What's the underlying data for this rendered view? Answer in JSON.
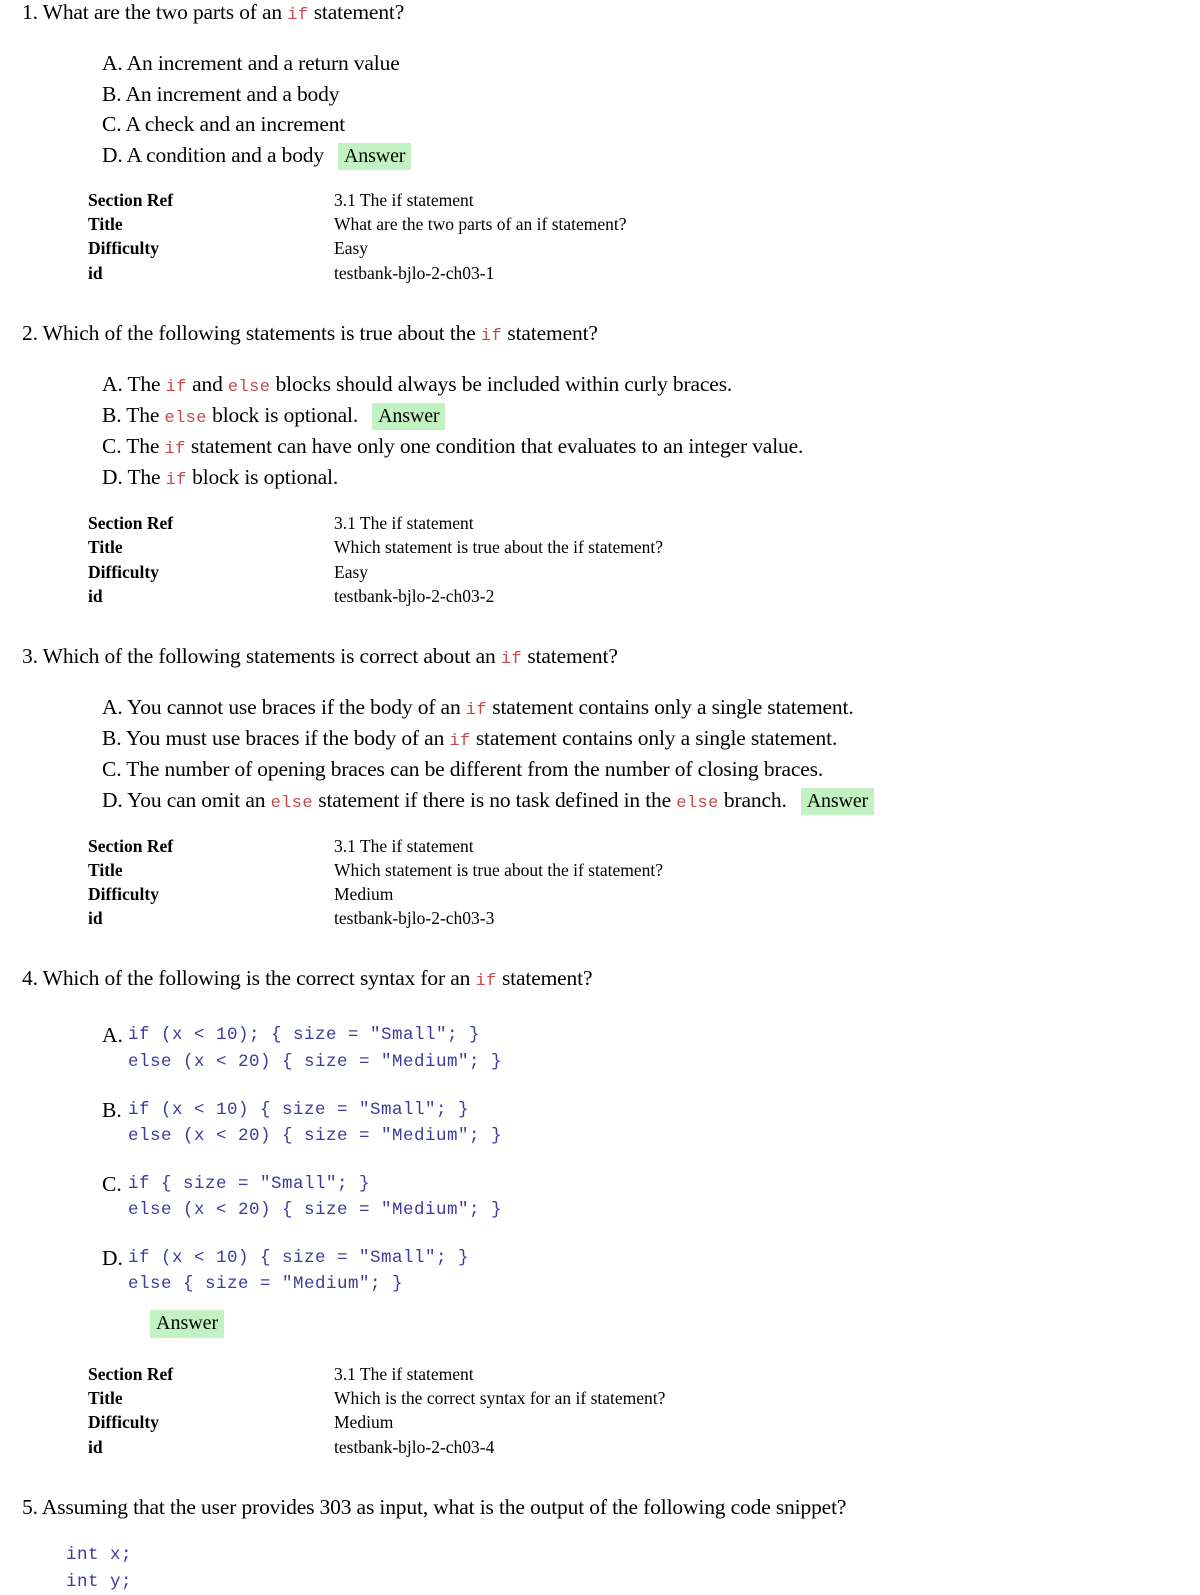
{
  "document": {
    "answer_badge_label": "Answer",
    "highlight_color": "#c3f2c2",
    "inline_code_color": "#c44b4b",
    "block_code_color": "#3b3b9e",
    "meta_labels": {
      "section_ref": "Section Ref",
      "title": "Title",
      "difficulty": "Difficulty",
      "id": "id"
    }
  },
  "questions": [
    {
      "number": "1.",
      "stem_parts": [
        {
          "type": "text",
          "value": "What are the two parts of an "
        },
        {
          "type": "code",
          "value": "if"
        },
        {
          "type": "text",
          "value": " statement?"
        }
      ],
      "stem_plain": "What are the two parts of an if statement?",
      "options": [
        {
          "letter": "A.",
          "text": "An increment and a return value",
          "answer": false
        },
        {
          "letter": "B.",
          "text": "An increment and a body",
          "answer": false
        },
        {
          "letter": "C.",
          "text": "A check and an increment",
          "answer": false
        },
        {
          "letter": "D.",
          "text": "A condition and a body",
          "answer": true
        }
      ],
      "meta": {
        "section_ref": "3.1 The if statement",
        "title": "What are the two parts of an if statement?",
        "difficulty": "Easy",
        "id": "testbank-bjlo-2-ch03-1"
      }
    },
    {
      "number": "2.",
      "stem_parts": [
        {
          "type": "text",
          "value": "Which of the following statements is true about the "
        },
        {
          "type": "code",
          "value": "if"
        },
        {
          "type": "text",
          "value": " statement?"
        }
      ],
      "stem_plain": "Which of the following statements is true about the if statement?",
      "options": [
        {
          "letter": "A.",
          "parts": [
            {
              "type": "text",
              "value": "The "
            },
            {
              "type": "code",
              "value": "if"
            },
            {
              "type": "text",
              "value": " and "
            },
            {
              "type": "code",
              "value": "else"
            },
            {
              "type": "text",
              "value": " blocks should always be included within curly braces."
            }
          ],
          "answer": false
        },
        {
          "letter": "B.",
          "parts": [
            {
              "type": "text",
              "value": "The "
            },
            {
              "type": "code",
              "value": "else"
            },
            {
              "type": "text",
              "value": " block is optional."
            }
          ],
          "answer": true
        },
        {
          "letter": "C.",
          "parts": [
            {
              "type": "text",
              "value": "The "
            },
            {
              "type": "code",
              "value": "if"
            },
            {
              "type": "text",
              "value": " statement can have only one condition that evaluates to an integer value."
            }
          ],
          "answer": false
        },
        {
          "letter": "D.",
          "parts": [
            {
              "type": "text",
              "value": "The "
            },
            {
              "type": "code",
              "value": "if"
            },
            {
              "type": "text",
              "value": " block is optional."
            }
          ],
          "answer": false
        }
      ],
      "meta": {
        "section_ref": "3.1 The if statement",
        "title": "Which statement is true about the if statement?",
        "difficulty": "Easy",
        "id": "testbank-bjlo-2-ch03-2"
      }
    },
    {
      "number": "3.",
      "stem_parts": [
        {
          "type": "text",
          "value": "Which of the following statements is correct about an "
        },
        {
          "type": "code",
          "value": "if"
        },
        {
          "type": "text",
          "value": " statement?"
        }
      ],
      "stem_plain": "Which of the following statements is correct about an if statement?",
      "options": [
        {
          "letter": "A.",
          "parts": [
            {
              "type": "text",
              "value": "You cannot use braces if the body of an "
            },
            {
              "type": "code",
              "value": "if"
            },
            {
              "type": "text",
              "value": " statement contains only a single statement."
            }
          ],
          "answer": false
        },
        {
          "letter": "B.",
          "parts": [
            {
              "type": "text",
              "value": "You must use braces if the body of an "
            },
            {
              "type": "code",
              "value": "if"
            },
            {
              "type": "text",
              "value": " statement contains only a single statement."
            }
          ],
          "answer": false
        },
        {
          "letter": "C.",
          "parts": [
            {
              "type": "text",
              "value": "The number of opening braces can be different from the number of closing braces."
            }
          ],
          "answer": false
        },
        {
          "letter": "D.",
          "parts": [
            {
              "type": "text",
              "value": "You can omit an "
            },
            {
              "type": "code",
              "value": "else"
            },
            {
              "type": "text",
              "value": " statement if there is no task defined in the "
            },
            {
              "type": "code",
              "value": "else"
            },
            {
              "type": "text",
              "value": " branch."
            }
          ],
          "answer": true
        }
      ],
      "meta": {
        "section_ref": "3.1 The if statement",
        "title": "Which statement is true about the if statement?",
        "difficulty": "Medium",
        "id": "testbank-bjlo-2-ch03-3"
      }
    },
    {
      "number": "4.",
      "stem_parts": [
        {
          "type": "text",
          "value": "Which of the following is the correct syntax for an "
        },
        {
          "type": "code",
          "value": "if"
        },
        {
          "type": "text",
          "value": " statement?"
        }
      ],
      "stem_plain": "Which of the following is the correct syntax for an if statement?",
      "code_options": [
        {
          "letter": "A.",
          "code": "if (x < 10); { size = \"Small\"; }\nelse (x < 20) { size = \"Medium\"; }",
          "answer": false
        },
        {
          "letter": "B.",
          "code": "if (x < 10) { size = \"Small\"; }\nelse (x < 20) { size = \"Medium\"; }",
          "answer": false
        },
        {
          "letter": "C.",
          "code": "if { size = \"Small\"; }\nelse (x < 20) { size = \"Medium\"; }",
          "answer": false
        },
        {
          "letter": "D.",
          "code": "if (x < 10) { size = \"Small\"; }\nelse { size = \"Medium\"; }",
          "answer": true
        }
      ],
      "meta": {
        "section_ref": "3.1 The if statement",
        "title": "Which is the correct syntax for an if statement?",
        "difficulty": "Medium",
        "id": "testbank-bjlo-2-ch03-4"
      }
    },
    {
      "number": "5.",
      "stem_parts": [
        {
          "type": "text",
          "value": "Assuming that the user provides 303 as input, what is the output of the following code snippet?"
        }
      ],
      "stem_plain": "Assuming that the user provides 303 as input, what is the output of the following code snippet?",
      "snippet": "int x;\nint y;"
    }
  ]
}
